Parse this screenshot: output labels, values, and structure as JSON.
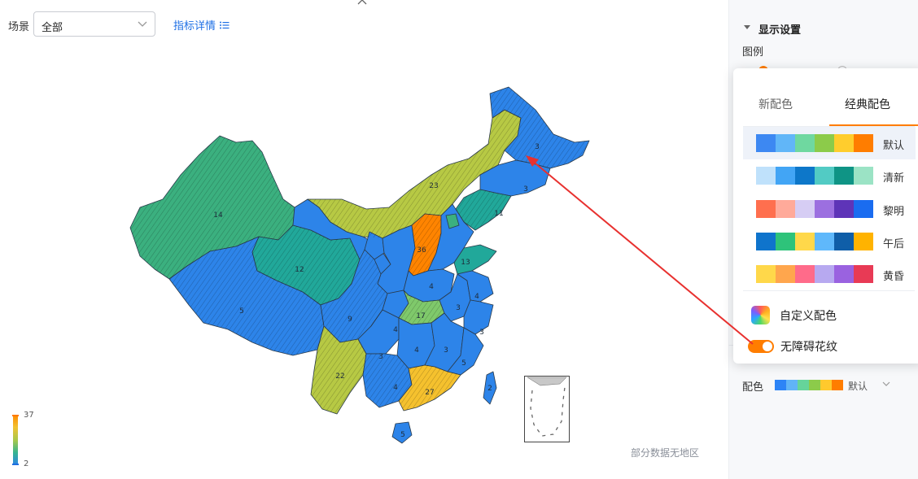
{
  "filter": {
    "scene_label": "场景",
    "scene_value": "全部",
    "detail_link": "指标详情"
  },
  "map": {
    "no_data_text": "部分数据无地区",
    "legend_max": "37",
    "legend_min": "2",
    "region_values": [
      "3",
      "3",
      "23",
      "11",
      "14",
      "12",
      "5",
      "9",
      "22",
      "36",
      "13",
      "4",
      "3",
      "4",
      "17",
      "3",
      "4",
      "4",
      "3",
      "3",
      "27",
      "5",
      "5",
      "4",
      "2"
    ],
    "colors": {
      "blue": "#2d84e9",
      "teal": "#21a89a",
      "green": "#3bb07f",
      "olive": "#b7c944",
      "yellow": "#f5c12e",
      "orange": "#ff8400",
      "light_green": "#7fc96b"
    }
  },
  "panel": {
    "section_title": "显示设置",
    "legend_label": "图例",
    "color_label": "配色",
    "color_value": "默认",
    "color_swatch": [
      "#2d84f6",
      "#61b4f6",
      "#66d49a",
      "#8ccb4a",
      "#ffc92d",
      "#ff7d00"
    ]
  },
  "popup": {
    "tab_new": "新配色",
    "tab_classic": "经典配色",
    "schemes": [
      {
        "name": "默认",
        "colors": [
          "#3d88f2",
          "#61b6f8",
          "#6fd8a0",
          "#8ccb4a",
          "#ffcd2d",
          "#ff7d00"
        ]
      },
      {
        "name": "清新",
        "colors": [
          "#bfe1fb",
          "#42a5f5",
          "#0d77c9",
          "#52cbc4",
          "#0f9485",
          "#9be3c5"
        ]
      },
      {
        "name": "黎明",
        "colors": [
          "#ff6f4e",
          "#ffaa9a",
          "#d6cdf4",
          "#9c6fe0",
          "#5e34b8",
          "#1a6cf0"
        ]
      },
      {
        "name": "午后",
        "colors": [
          "#0f74cc",
          "#2ec37a",
          "#ffd84a",
          "#5fb8fb",
          "#0f5ea8",
          "#ffb300"
        ]
      },
      {
        "name": "黄昏",
        "colors": [
          "#ffd84a",
          "#ffa64d",
          "#ff6b8a",
          "#b7a9f0",
          "#9a62e0",
          "#e83a55"
        ]
      }
    ],
    "custom_label": "自定义配色",
    "toggle_label": "无障碍花纹"
  }
}
